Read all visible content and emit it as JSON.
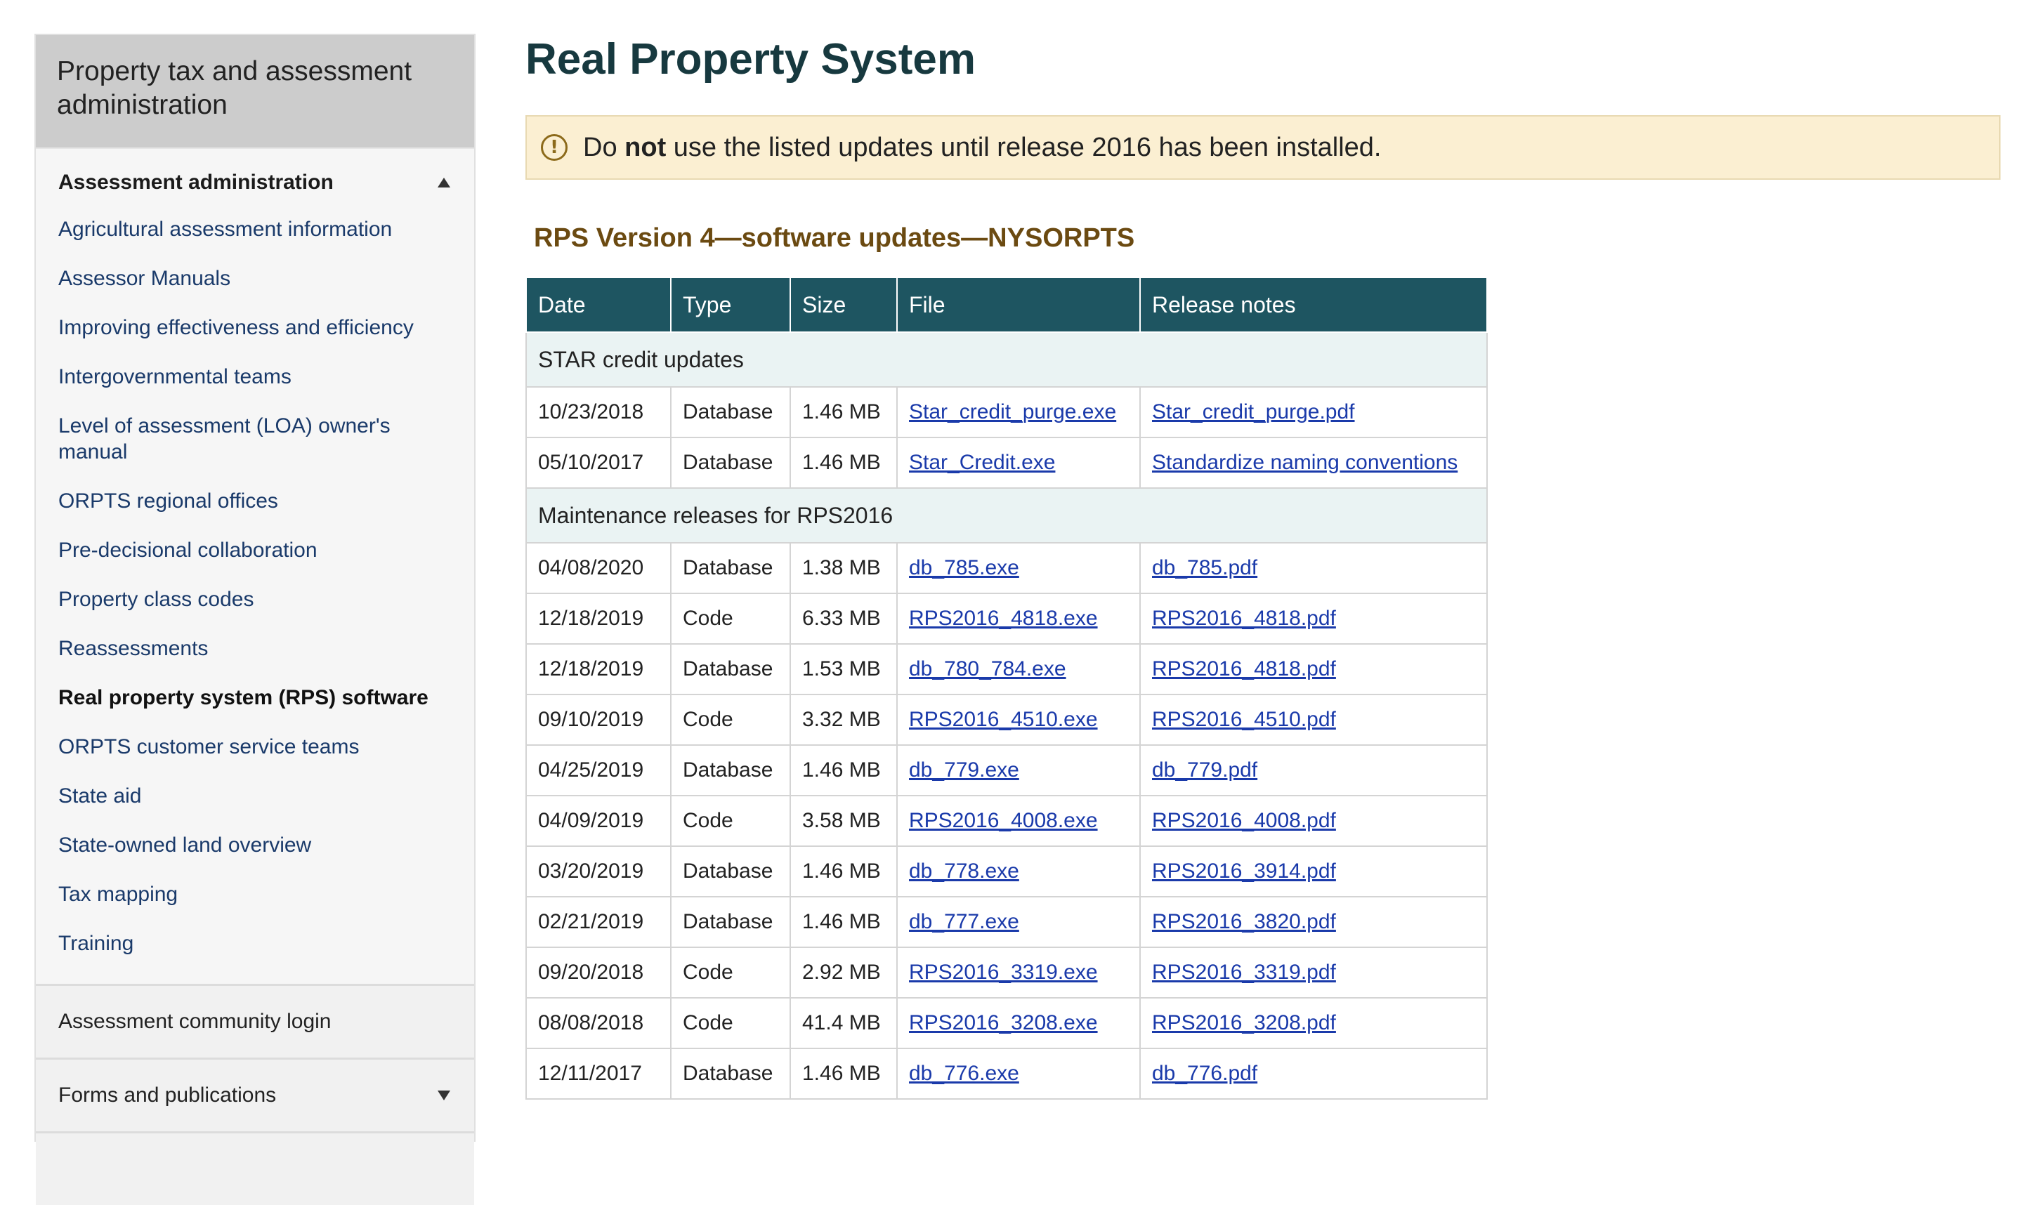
{
  "sidebar": {
    "header": "Property tax and assessment administration",
    "section_title": "Assessment administration",
    "items": [
      {
        "label": "Agricultural assessment information"
      },
      {
        "label": "Assessor Manuals"
      },
      {
        "label": "Improving effectiveness and efficiency"
      },
      {
        "label": "Intergovernmental teams"
      },
      {
        "label": "Level of assessment (LOA) owner's manual"
      },
      {
        "label": "ORPTS regional offices"
      },
      {
        "label": "Pre-decisional collaboration"
      },
      {
        "label": "Property class codes"
      },
      {
        "label": "Reassessments"
      },
      {
        "label": "Real property system (RPS) software"
      },
      {
        "label": "ORPTS customer service teams"
      },
      {
        "label": "State aid"
      },
      {
        "label": "State-owned land overview"
      },
      {
        "label": "Tax mapping"
      },
      {
        "label": "Training"
      }
    ],
    "login_label": "Assessment community login",
    "forms_label": "Forms and publications"
  },
  "page": {
    "title": "Real Property System",
    "alert": {
      "prefix": "Do",
      "bold": "not",
      "suffix": "use the listed updates until release 2016 has been installed."
    },
    "section_title": "RPS Version 4—software updates—NYSORPTS"
  },
  "table": {
    "headers": [
      "Date",
      "Type",
      "Size",
      "File",
      "Release notes"
    ],
    "groups": [
      {
        "title": "STAR credit updates",
        "rows": [
          {
            "date": "10/23/2018",
            "type": "Database",
            "size": "1.46 MB",
            "file": "Star_credit_purge.exe",
            "notes": "Star_credit_purge.pdf"
          },
          {
            "date": "05/10/2017",
            "type": "Database",
            "size": "1.46 MB",
            "file": "Star_Credit.exe",
            "notes": "Standardize naming conventions"
          }
        ]
      },
      {
        "title": "Maintenance releases for RPS2016",
        "rows": [
          {
            "date": "04/08/2020",
            "type": "Database",
            "size": "1.38 MB",
            "file": "db_785.exe",
            "notes": "db_785.pdf"
          },
          {
            "date": "12/18/2019",
            "type": "Code",
            "size": "6.33 MB",
            "file": "RPS2016_4818.exe",
            "notes": "RPS2016_4818.pdf"
          },
          {
            "date": "12/18/2019",
            "type": "Database",
            "size": "1.53 MB",
            "file": "db_780_784.exe",
            "notes": "RPS2016_4818.pdf"
          },
          {
            "date": "09/10/2019",
            "type": "Code",
            "size": "3.32 MB",
            "file": "RPS2016_4510.exe",
            "notes": "RPS2016_4510.pdf"
          },
          {
            "date": "04/25/2019",
            "type": "Database",
            "size": "1.46 MB",
            "file": "db_779.exe",
            "notes": "db_779.pdf"
          },
          {
            "date": "04/09/2019",
            "type": "Code",
            "size": "3.58 MB",
            "file": "RPS2016_4008.exe",
            "notes": "RPS2016_4008.pdf"
          },
          {
            "date": "03/20/2019",
            "type": "Database",
            "size": "1.46 MB",
            "file": "db_778.exe",
            "notes": "RPS2016_3914.pdf"
          },
          {
            "date": "02/21/2019",
            "type": "Database",
            "size": "1.46 MB",
            "file": "db_777.exe",
            "notes": "RPS2016_3820.pdf"
          },
          {
            "date": "09/20/2018",
            "type": "Code",
            "size": "2.92 MB",
            "file": "RPS2016_3319.exe",
            "notes": "RPS2016_3319.pdf"
          },
          {
            "date": "08/08/2018",
            "type": "Code",
            "size": "41.4 MB",
            "file": "RPS2016_3208.exe",
            "notes": "RPS2016_3208.pdf"
          },
          {
            "date": "12/11/2017",
            "type": "Database",
            "size": "1.46 MB",
            "file": "db_776.exe",
            "notes": "db_776.pdf"
          }
        ]
      }
    ]
  },
  "colors": {
    "header_teal": "#1e5561",
    "title": "#17393f",
    "section_title": "#6b4a11",
    "alert_bg": "#fbefd2",
    "link": "#1a3aaa"
  }
}
